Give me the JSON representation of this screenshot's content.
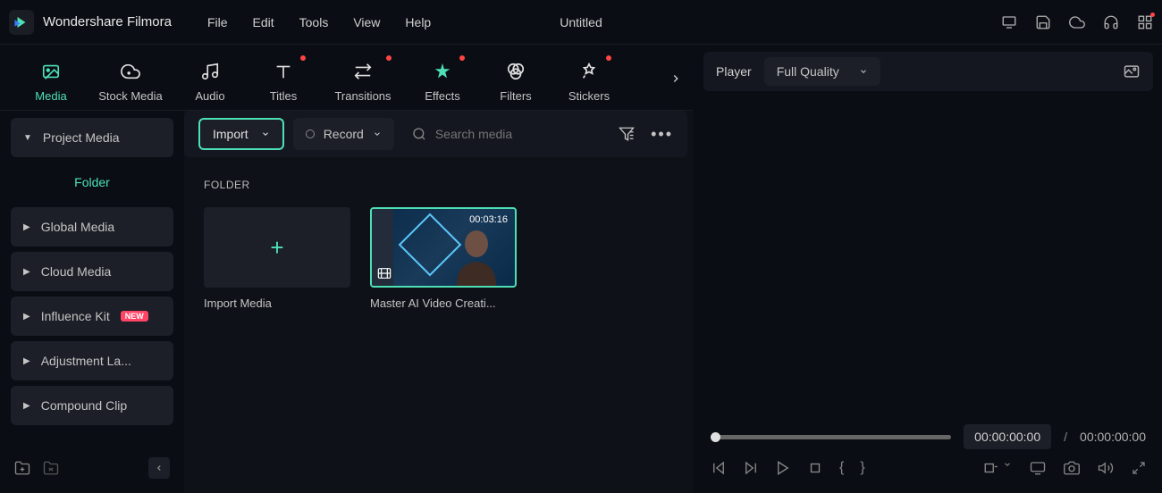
{
  "brand": "Wondershare Filmora",
  "menu": [
    "File",
    "Edit",
    "Tools",
    "View",
    "Help"
  ],
  "title": "Untitled",
  "tabs": [
    {
      "label": "Media",
      "active": true,
      "dot": false
    },
    {
      "label": "Stock Media",
      "active": false,
      "dot": false
    },
    {
      "label": "Audio",
      "active": false,
      "dot": false
    },
    {
      "label": "Titles",
      "active": false,
      "dot": true
    },
    {
      "label": "Transitions",
      "active": false,
      "dot": true
    },
    {
      "label": "Effects",
      "active": false,
      "dot": true
    },
    {
      "label": "Filters",
      "active": false,
      "dot": false
    },
    {
      "label": "Stickers",
      "active": false,
      "dot": true
    }
  ],
  "sidebar": {
    "project_media": "Project Media",
    "folder": "Folder",
    "global_media": "Global Media",
    "cloud_media": "Cloud Media",
    "influence_kit": "Influence Kit",
    "new_badge": "NEW",
    "adjustment_layer": "Adjustment La...",
    "compound_clip": "Compound Clip"
  },
  "toolbar": {
    "import": "Import",
    "record": "Record",
    "search_placeholder": "Search media"
  },
  "folder_section": "FOLDER",
  "media": {
    "import_tile": "Import Media",
    "clip1_time": "00:03:16",
    "clip1_name": "Master AI Video Creati..."
  },
  "player": {
    "label": "Player",
    "quality": "Full Quality",
    "current_time": "00:00:00:00",
    "total_time": "00:00:00:00"
  }
}
